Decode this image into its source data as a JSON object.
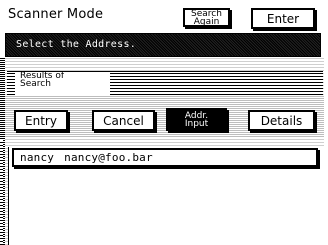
{
  "header": {
    "title": "Scanner Mode",
    "search_again_line1": "Search",
    "search_again_line2": "Again",
    "enter_label": "Enter"
  },
  "message": "Select the Address.",
  "tab": {
    "line1": "Results of",
    "line2": "Search"
  },
  "actions": {
    "entry": "Entry",
    "cancel": "Cancel",
    "addr_input_line1": "Addr.",
    "addr_input_line2": "Input",
    "details": "Details"
  },
  "results": [
    {
      "name": "nancy",
      "email": "nancy@foo.bar"
    }
  ]
}
